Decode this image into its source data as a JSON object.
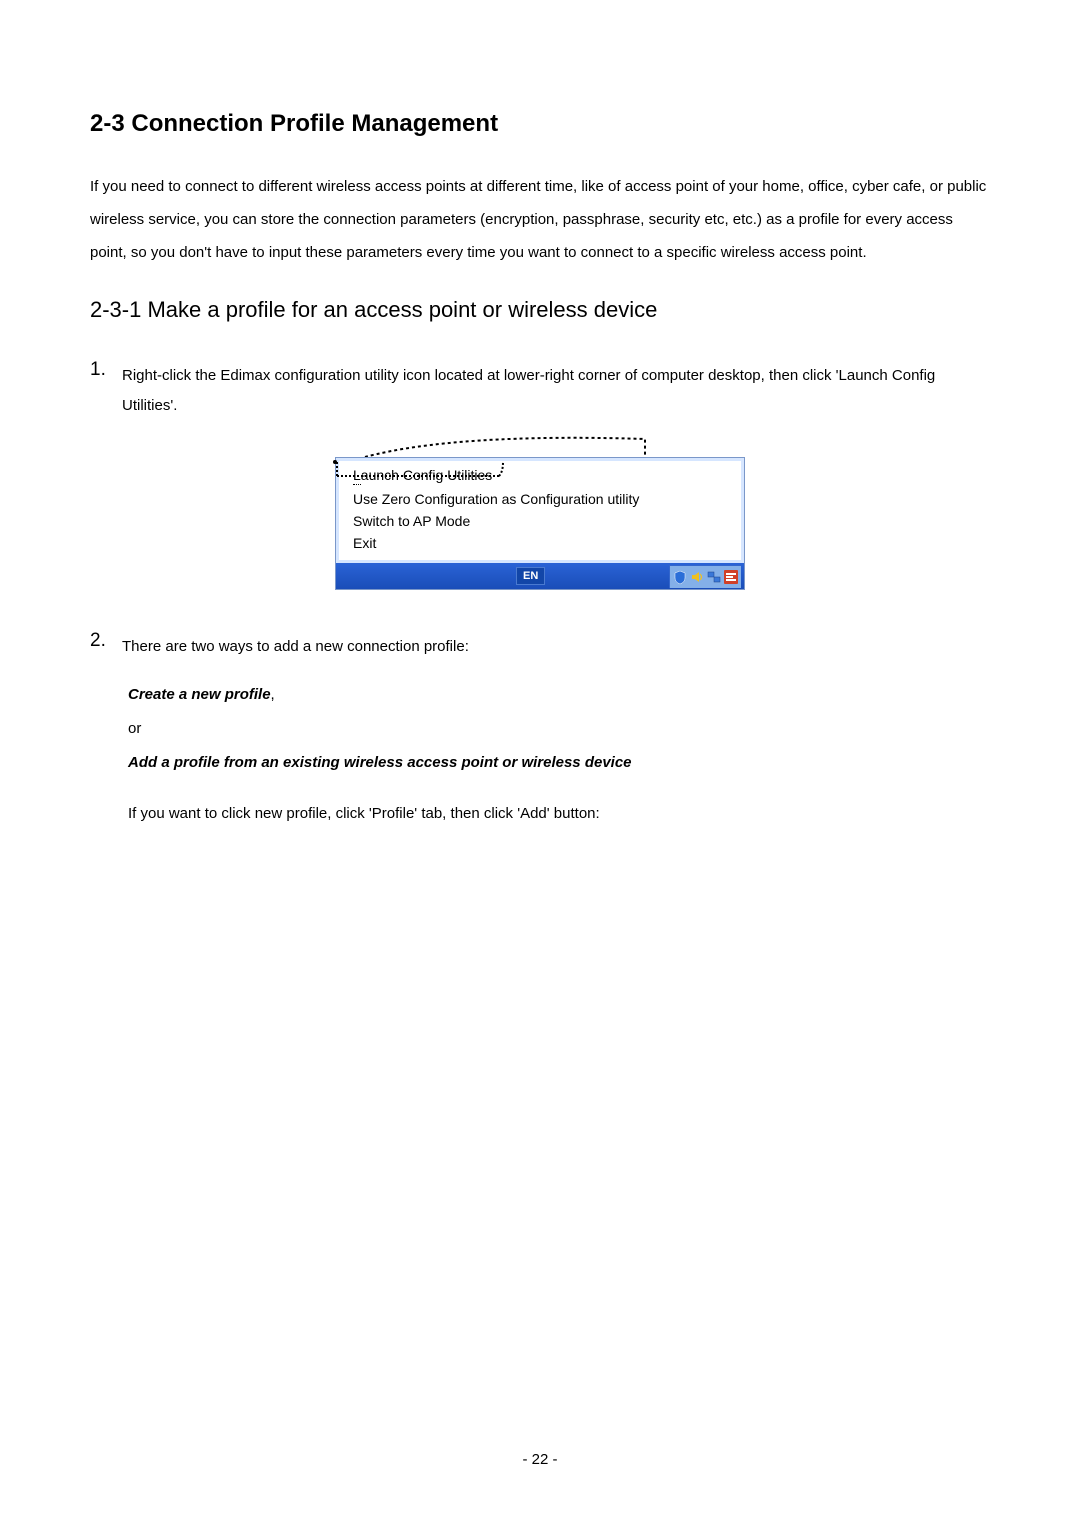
{
  "title": "2-3 Connection Profile Management",
  "intro": "If you need to connect to different wireless access points at different time, like of access point of your home, office, cyber cafe, or public wireless service, you can store the connection parameters (encryption, passphrase, security etc, etc.) as a profile for every access point, so you don't have to input these parameters every time you want to connect to a specific wireless access point.",
  "subheading": "2-3-1 Make a profile for an access point or wireless device",
  "step1_num": "1.",
  "step1_text": "Right-click the Edimax configuration utility icon located at lower-right corner of computer desktop, then click 'Launch Config Utilities'.",
  "menu": {
    "item1_prefix": "L",
    "item1_rest": "aunch Config Utilities",
    "item2": "Use Zero Configuration as Configuration utility",
    "item3": "Switch to AP Mode",
    "item4": "Exit",
    "lang": "EN"
  },
  "step2_num": "2.",
  "step2_text": "There are two ways to add a new connection profile:",
  "create_label": "Create a new profile",
  "create_suffix": ",",
  "or_label": "or",
  "add_label": "Add a profile from an existing wireless access point or wireless device",
  "click_text": "If you want to click new profile, click 'Profile' tab, then click 'Add' button:",
  "page_number": "- 22 -"
}
